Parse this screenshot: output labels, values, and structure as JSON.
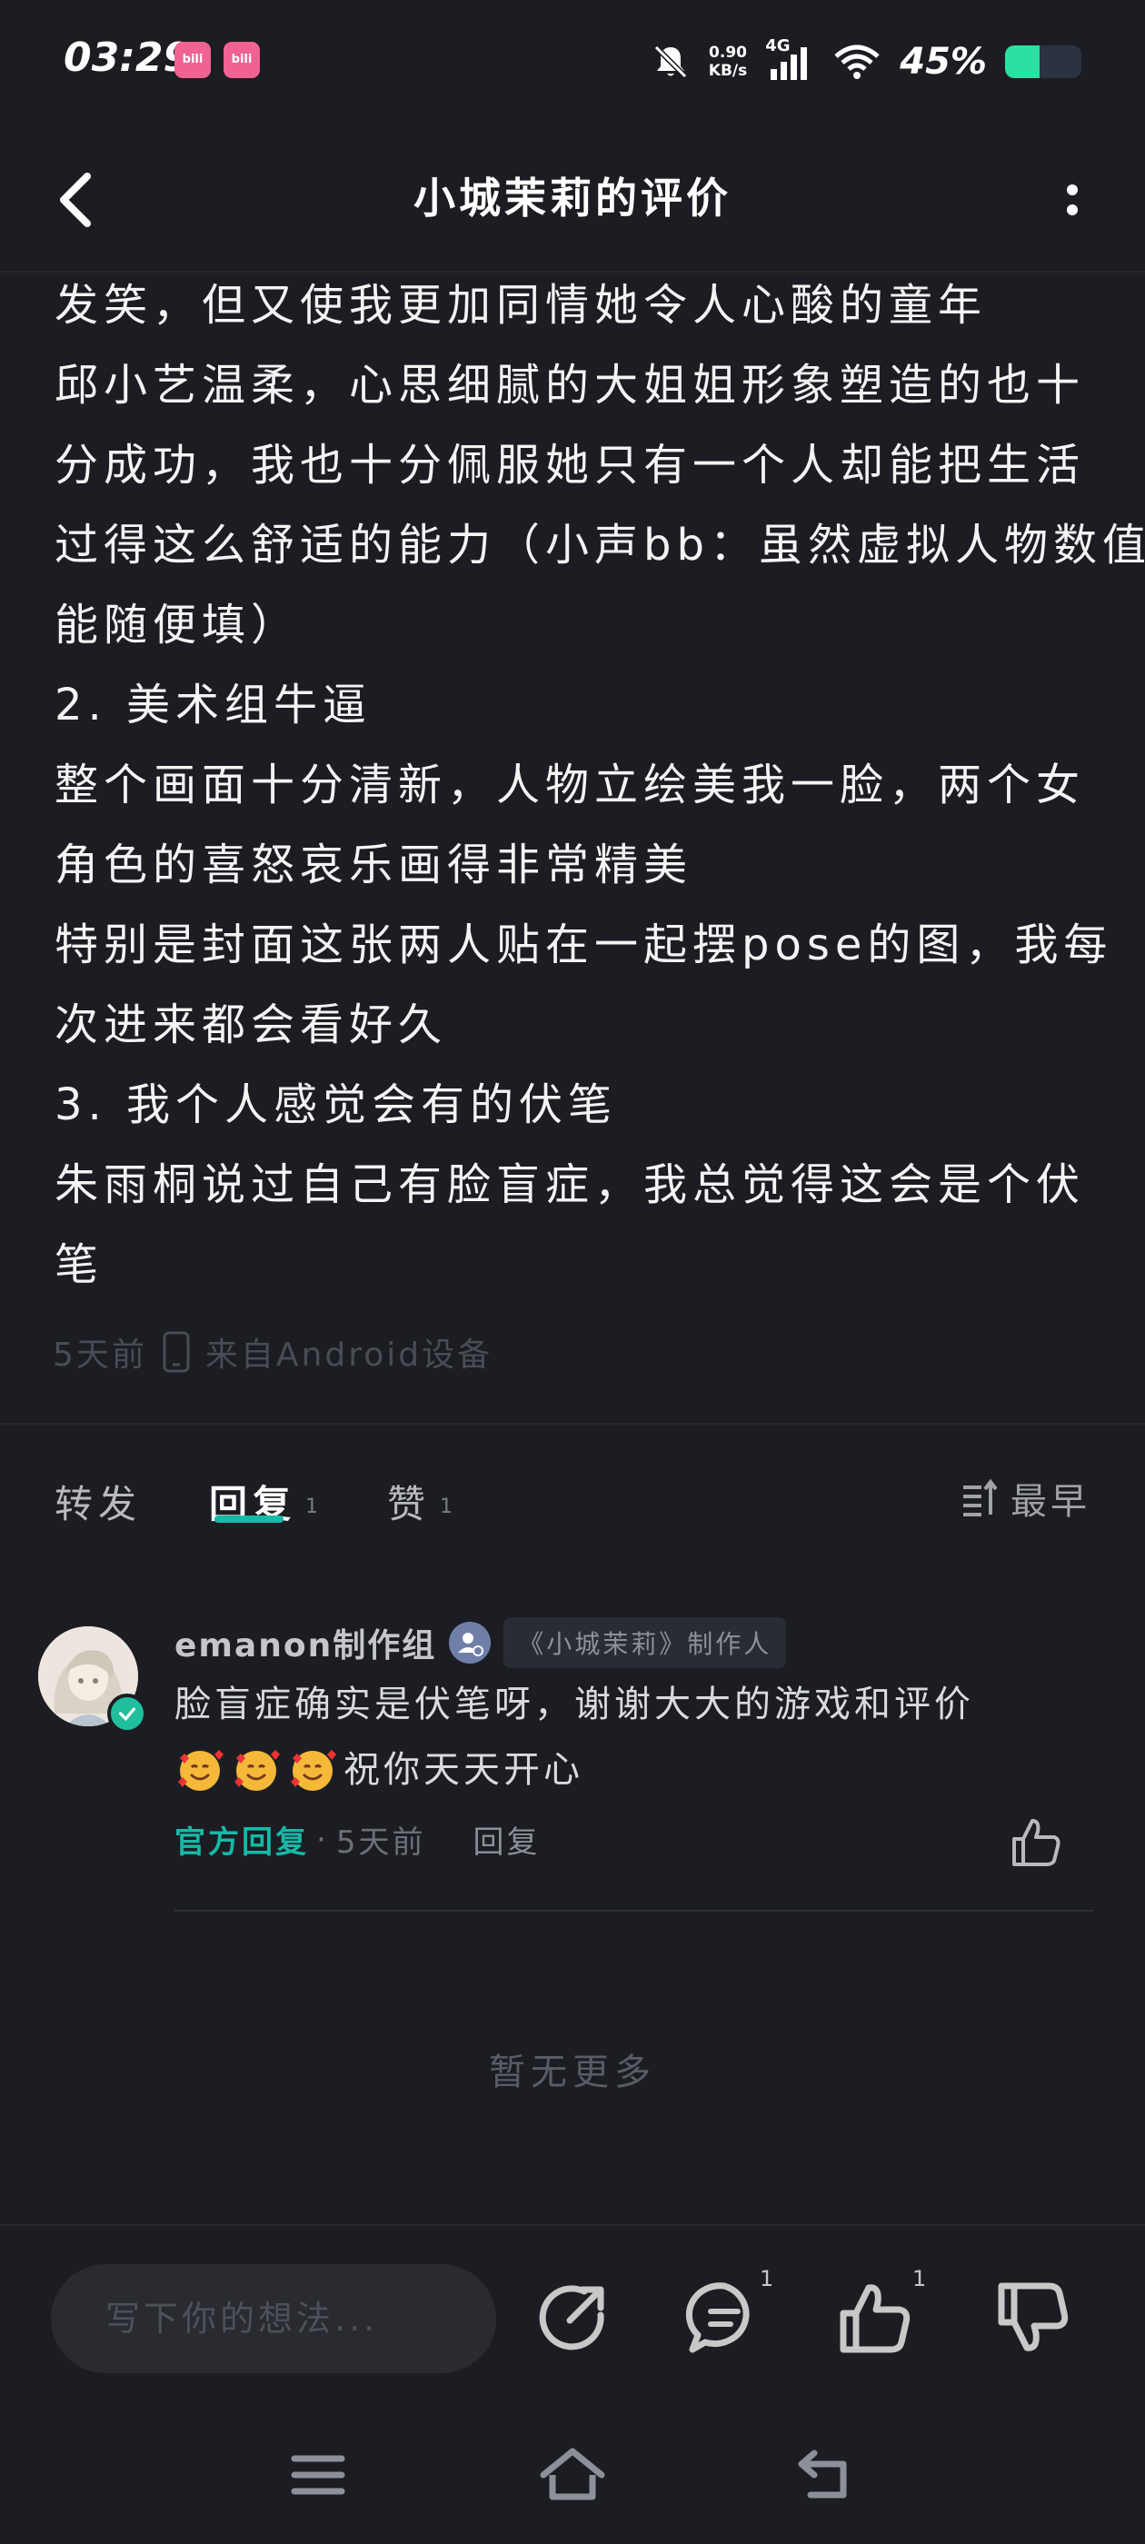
{
  "status_bar": {
    "time": "03:29",
    "app_icons": [
      "bilibili",
      "bilibili"
    ],
    "speed_value": "0.90",
    "speed_unit": "KB/s",
    "network": "4G",
    "battery_text": "45%",
    "battery_level": 0.45,
    "icons": [
      "bilibili-icon",
      "mute-bell-icon",
      "signal-icon",
      "wifi-icon",
      "battery-icon"
    ]
  },
  "header": {
    "title": "小城茉莉的评价",
    "back_icon": "chevron-left-icon",
    "more_icon": "more-vertical-icon"
  },
  "review": {
    "lines": [
      "发笑，但又使我更加同情她令人心酸的童年",
      "邱小艺温柔，心思细腻的大姐姐形象塑造的也十",
      "分成功，我也十分佩服她只有一个人却能把生活",
      "过得这么舒适的能力（小声bb：虽然虚拟人物数值",
      "能随便填）",
      "2. 美术组牛逼",
      "整个画面十分清新，人物立绘美我一脸，两个女",
      "角色的喜怒哀乐画得非常精美",
      "特别是封面这张两人贴在一起摆pose的图，我每",
      "次进来都会看好久",
      "3. 我个人感觉会有的伏笔",
      "朱雨桐说过自己有脸盲症，我总觉得这会是个伏",
      "笔"
    ],
    "time": "5天前",
    "device": "来自Android设备"
  },
  "tabs": [
    {
      "label": "转发",
      "count": ""
    },
    {
      "label": "回复",
      "count": "1"
    },
    {
      "label": "赞",
      "count": "1"
    }
  ],
  "sort_label": "最早",
  "comment": {
    "author": "emanon制作组",
    "tag": "《小城茉莉》制作人",
    "text": "脸盲症确实是伏笔呀，谢谢大大的游戏和评价",
    "text2": "祝你天天开心",
    "official": "官方回复",
    "dot": "·",
    "time": "5天前",
    "reply": "回复"
  },
  "no_more": "暂无更多",
  "action_bar": {
    "placeholder": "写下你的想法...",
    "reply_count": "1",
    "like_count": "1"
  },
  "colors": {
    "background": "#1c1d22",
    "accent": "#17b9a8",
    "battery": "#2be0a0"
  }
}
